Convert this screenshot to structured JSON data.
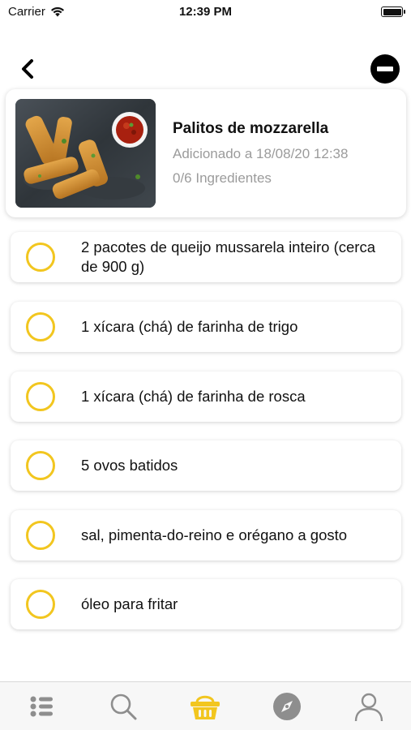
{
  "status_bar": {
    "carrier": "Carrier",
    "time": "12:39 PM"
  },
  "nav": {
    "back_icon": "chevron-left-icon",
    "remove_icon": "minus-circle-icon"
  },
  "recipe": {
    "title": "Palitos de mozzarella",
    "added": "Adicionado a 18/08/20 12:38",
    "ingredient_count": "0/6 Ingredientes"
  },
  "ingredients": [
    {
      "text": "2 pacotes de queijo mussarela inteiro (cerca de 900 g)",
      "checked": false
    },
    {
      "text": "1 xícara (chá) de farinha de trigo",
      "checked": false
    },
    {
      "text": "1 xícara (chá) de farinha de rosca",
      "checked": false
    },
    {
      "text": "5 ovos batidos",
      "checked": false
    },
    {
      "text": "sal, pimenta-do-reino e orégano a gosto",
      "checked": false
    },
    {
      "text": "óleo para fritar",
      "checked": false
    }
  ],
  "tabs": [
    {
      "icon": "list-icon",
      "active": false
    },
    {
      "icon": "search-icon",
      "active": false
    },
    {
      "icon": "basket-icon",
      "active": true
    },
    {
      "icon": "compass-icon",
      "active": false
    },
    {
      "icon": "user-icon",
      "active": false
    }
  ],
  "colors": {
    "accent": "#f2c61f",
    "muted_text": "#9b9b9b",
    "inactive_icon": "#8e8e8e"
  }
}
